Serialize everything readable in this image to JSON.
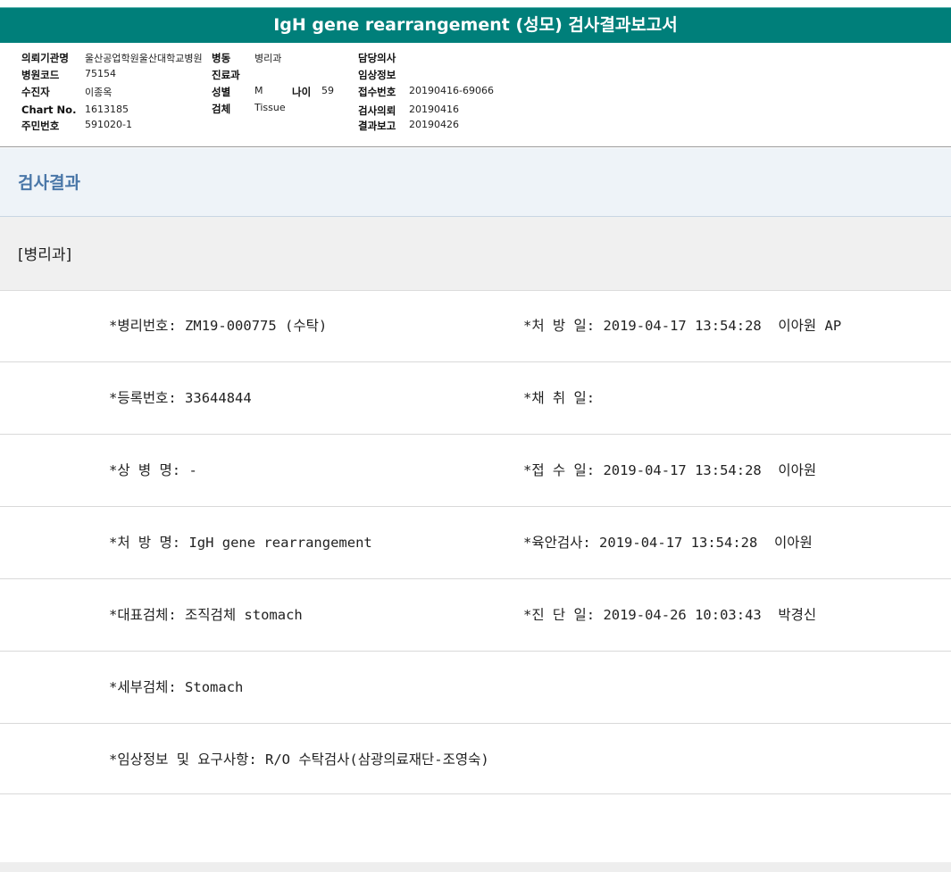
{
  "title": "IgH gene rearrangement (성모) 검사결과보고서",
  "info": {
    "institution_label": "의뢰기관명",
    "institution_value": "울산공업학원울산대학교병원",
    "ward_label": "병동",
    "ward_value": "병리과",
    "doctor_label": "담당의사",
    "doctor_value": "",
    "hospital_code_label": "병원코드",
    "hospital_code_value": "75154",
    "dept_label": "진료과",
    "dept_value": "",
    "clinical_label": "임상정보",
    "clinical_value": "",
    "patient_label": "수진자",
    "patient_value": "이종옥",
    "sex_label": "성별",
    "sex_value": "M",
    "age_label": "나이",
    "age_value": "59",
    "receipt_label": "접수번호",
    "receipt_value": "20190416-69066",
    "chart_label": "Chart No.",
    "chart_value": "1613185",
    "specimen_label": "검체",
    "specimen_value": "Tissue",
    "request_label": "검사의뢰",
    "request_value": "20190416",
    "id_label": "주민번호",
    "id_value": "591020-1",
    "report_label": "결과보고",
    "report_value": "20190426"
  },
  "section_title": "검사결과",
  "department": "[병리과]",
  "rows": [
    {
      "left": "*병리번호: ZM19-000775 (수탁)",
      "right": "*처 방 일: 2019-04-17 13:54:28  이아원 AP"
    },
    {
      "left": "*등록번호: 33644844",
      "right": "*채 취 일:"
    },
    {
      "left": "*상 병 명: -",
      "right": "*접 수 일: 2019-04-17 13:54:28  이아원"
    },
    {
      "left": "*처 방 명: IgH gene rearrangement",
      "right": "*육안검사: 2019-04-17 13:54:28  이아원"
    },
    {
      "left": "*대표검체: 조직검체 stomach",
      "right": "*진 단 일: 2019-04-26 10:03:43  박경신"
    },
    {
      "left": "*세부검체: Stomach",
      "right": ""
    },
    {
      "left": "*임상정보 및 요구사항: R/O 수탁검사(삼광의료재단-조영숙)",
      "right": ""
    }
  ]
}
